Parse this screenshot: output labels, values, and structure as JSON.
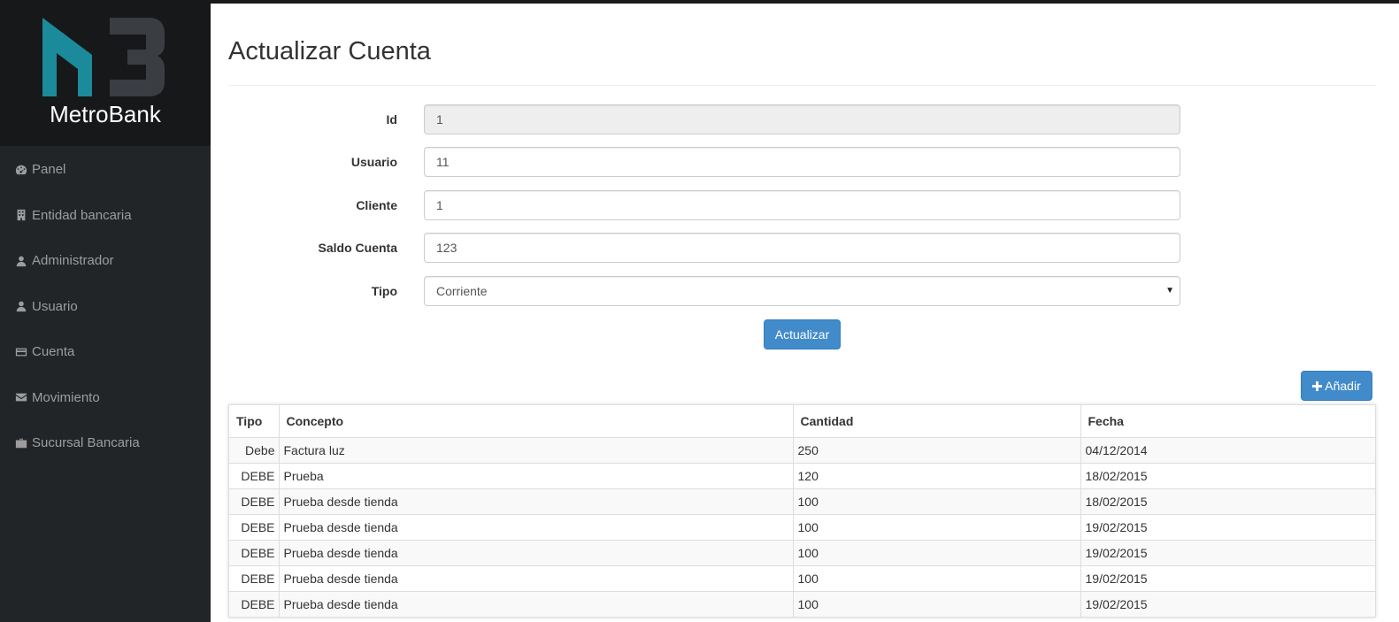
{
  "brand": {
    "name": "MetroBank"
  },
  "nav": [
    {
      "label": "Panel",
      "icon": "dashboard-icon"
    },
    {
      "label": "Entidad bancaria",
      "icon": "building-icon"
    },
    {
      "label": "Administrador",
      "icon": "user-icon"
    },
    {
      "label": "Usuario",
      "icon": "user-icon"
    },
    {
      "label": "Cuenta",
      "icon": "credit-card-icon"
    },
    {
      "label": "Movimiento",
      "icon": "envelope-icon"
    },
    {
      "label": "Sucursal Bancaria",
      "icon": "briefcase-icon"
    }
  ],
  "page": {
    "title": "Actualizar Cuenta"
  },
  "form": {
    "id": {
      "label": "Id",
      "value": "1"
    },
    "usuario": {
      "label": "Usuario",
      "value": "11"
    },
    "cliente": {
      "label": "Cliente",
      "value": "1"
    },
    "saldo": {
      "label": "Saldo Cuenta",
      "value": "123"
    },
    "tipo": {
      "label": "Tipo",
      "value": "Corriente"
    },
    "submit_label": "Actualizar"
  },
  "add_button": {
    "label": "Añadir"
  },
  "table": {
    "headers": {
      "tipo": "Tipo",
      "concepto": "Concepto",
      "cantidad": "Cantidad",
      "fecha": "Fecha"
    },
    "rows": [
      {
        "tipo": "Debe",
        "concepto": "Factura luz",
        "cantidad": "250",
        "fecha": "04/12/2014"
      },
      {
        "tipo": "DEBE",
        "concepto": "Prueba",
        "cantidad": "120",
        "fecha": "18/02/2015"
      },
      {
        "tipo": "DEBE",
        "concepto": "Prueba desde tienda",
        "cantidad": "100",
        "fecha": "18/02/2015"
      },
      {
        "tipo": "DEBE",
        "concepto": "Prueba desde tienda",
        "cantidad": "100",
        "fecha": "19/02/2015"
      },
      {
        "tipo": "DEBE",
        "concepto": "Prueba desde tienda",
        "cantidad": "100",
        "fecha": "19/02/2015"
      },
      {
        "tipo": "DEBE",
        "concepto": "Prueba desde tienda",
        "cantidad": "100",
        "fecha": "19/02/2015"
      },
      {
        "tipo": "DEBE",
        "concepto": "Prueba desde tienda",
        "cantidad": "100",
        "fecha": "19/02/2015"
      }
    ]
  },
  "colors": {
    "sidebar": "#222528",
    "brand_bg": "#171819",
    "primary": "#428bca",
    "logo_teal": "#1b8a9b",
    "logo_gray": "#3a3d42"
  }
}
